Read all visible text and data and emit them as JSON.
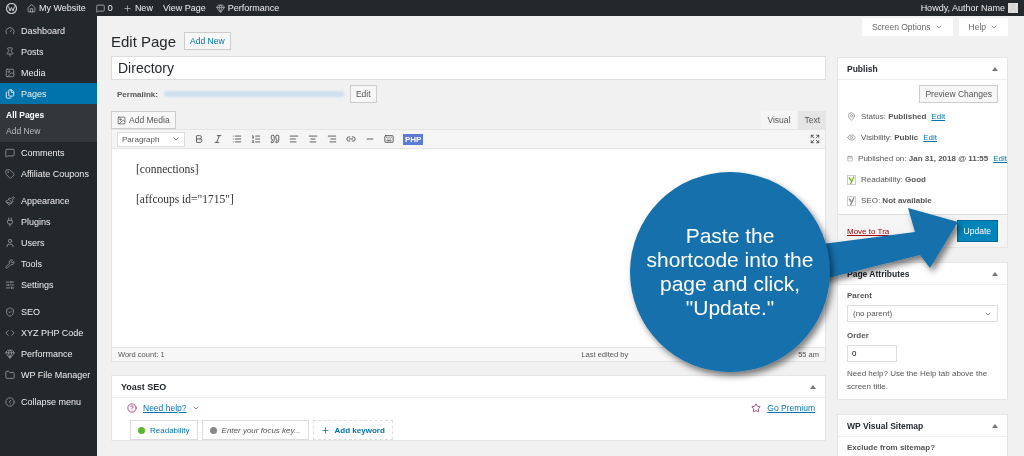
{
  "admin_bar": {
    "items": [
      {
        "label": "My Website"
      },
      {
        "label": "0"
      },
      {
        "label": "New"
      },
      {
        "label": "View Page"
      },
      {
        "label": "Performance"
      }
    ],
    "greeting": "Howdy, Author Name"
  },
  "screen_meta": [
    "Screen Options",
    "Help"
  ],
  "sidebar": {
    "items": [
      {
        "label": "Dashboard",
        "selected": false
      },
      {
        "label": "Posts",
        "selected": false
      },
      {
        "label": "Media",
        "selected": false
      },
      {
        "label": "Pages",
        "selected": true,
        "children": [
          {
            "label": "All Pages",
            "selected": true
          },
          {
            "label": "Add New",
            "selected": false
          }
        ]
      },
      {
        "label": "Comments",
        "selected": false
      },
      {
        "label": "Affiliate Coupons",
        "selected": false
      },
      {
        "label": "Appearance",
        "selected": false
      },
      {
        "label": "Plugins",
        "selected": false
      },
      {
        "label": "Users",
        "selected": false
      },
      {
        "label": "Tools",
        "selected": false
      },
      {
        "label": "Settings",
        "selected": false
      },
      {
        "label": "SEO",
        "selected": false
      },
      {
        "label": "XYZ PHP Code",
        "selected": false
      },
      {
        "label": "Performance",
        "selected": false
      },
      {
        "label": "WP File Manager",
        "selected": false
      },
      {
        "label": "Collapse menu",
        "selected": false
      }
    ]
  },
  "heading": "Edit Page",
  "add_new": "Add New",
  "title_value": "Directory",
  "permalink": {
    "label": "Permalink:",
    "edit": "Edit"
  },
  "editor": {
    "add_media": "Add Media",
    "tabs": [
      {
        "label": "Visual",
        "selected": true
      },
      {
        "label": "Text",
        "selected": false
      }
    ],
    "format": "Paragraph",
    "php_button": "PHP",
    "lines": [
      "[connections]",
      "[affcoups id=\"1715\"]"
    ],
    "word_count": "Word count: 1",
    "last_edited": "Last edited by",
    "last_edited_end": "55 am"
  },
  "yoast": {
    "title": "Yoast SEO",
    "need_help": "Need help?",
    "go_premium": "Go Premium",
    "tabs": [
      {
        "kind": "status",
        "label": "Readability",
        "color": "#5ab82f"
      },
      {
        "kind": "placeholder",
        "label": "Enter your focus key...",
        "color": "#888888"
      },
      {
        "kind": "add",
        "label": "Add keyword"
      }
    ]
  },
  "publish": {
    "title": "Publish",
    "preview": "Preview Changes",
    "rows": [
      {
        "label": "Status:",
        "value": "Published",
        "link": "Edit"
      },
      {
        "label": "Visibility:",
        "value": "Public",
        "link": "Edit"
      },
      {
        "label": "Published on:",
        "value": "Jan 31, 2018 @ 11:55",
        "link": "Edit"
      },
      {
        "label": "Readability:",
        "value": "Good"
      },
      {
        "label": "SEO:",
        "value": "Not available"
      }
    ],
    "trash": "Move to Tra",
    "update": "Update"
  },
  "page_attributes": {
    "title": "Page Attributes",
    "parent_label": "Parent",
    "parent_value": "(no parent)",
    "order_label": "Order",
    "order_value": "0",
    "help": "Need help? Use the Help tab above the screen title."
  },
  "sitemap": {
    "title": "WP Visual Sitemap",
    "question": "Exclude from sitemap?"
  },
  "callout": "Paste the shortcode into the page and click, \"Update.\""
}
